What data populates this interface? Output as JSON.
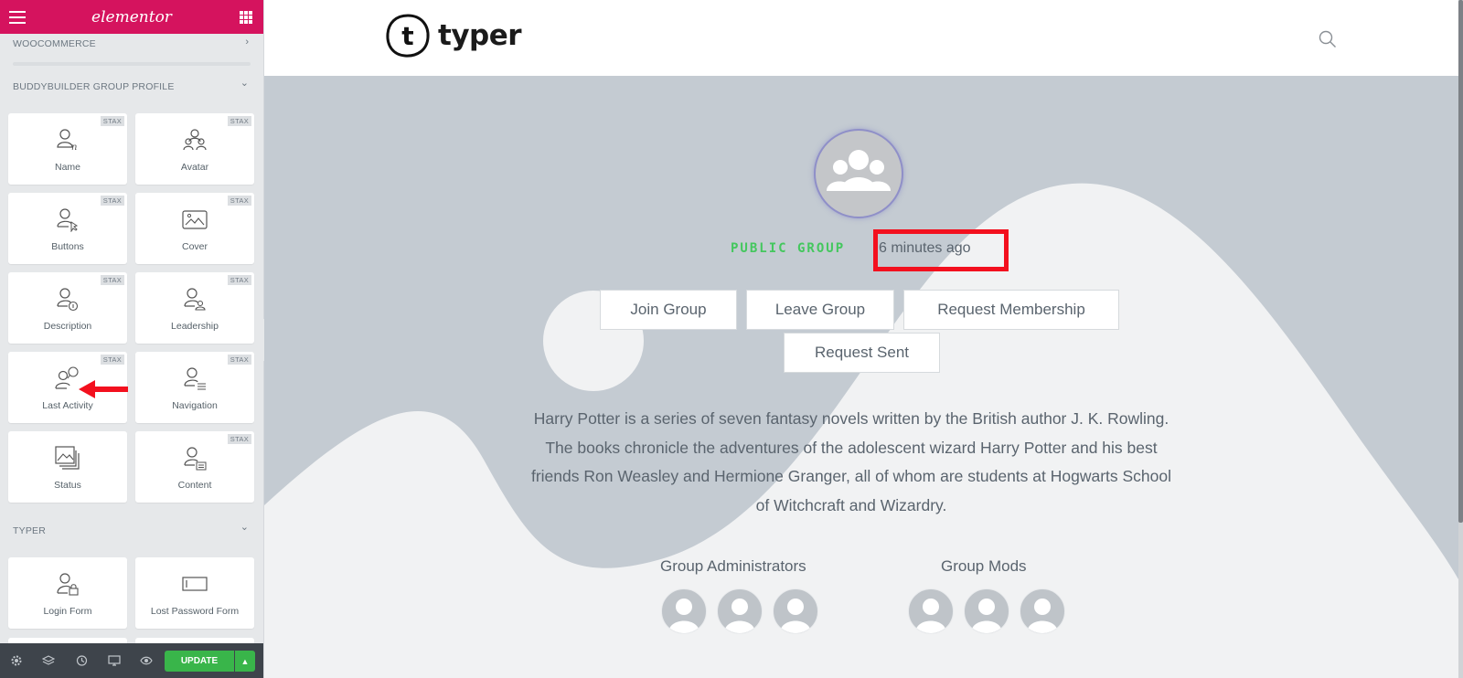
{
  "editor": {
    "logo": "elementor",
    "categories": [
      {
        "title": "WOOCOMMERCE",
        "chevron": "›"
      },
      {
        "title": "BUDDYBUILDER GROUP PROFILE",
        "chevron": "⌄"
      },
      {
        "title": "TYPER",
        "chevron": "⌄"
      }
    ],
    "badge": "STAX",
    "widgets_group_profile": [
      {
        "label": "Name",
        "icon": "user-name-icon"
      },
      {
        "label": "Avatar",
        "icon": "group-avatar-icon"
      },
      {
        "label": "Buttons",
        "icon": "user-cursor-icon"
      },
      {
        "label": "Cover",
        "icon": "cover-image-icon"
      },
      {
        "label": "Description",
        "icon": "user-info-icon"
      },
      {
        "label": "Leadership",
        "icon": "user-leader-icon"
      },
      {
        "label": "Last Activity",
        "icon": "user-activity-icon"
      },
      {
        "label": "Navigation",
        "icon": "user-navigation-icon"
      },
      {
        "label": "Status",
        "icon": "gallery-icon"
      },
      {
        "label": "Content",
        "icon": "user-content-icon"
      }
    ],
    "widgets_typer": [
      {
        "label": "Login Form",
        "icon": "user-lock-icon"
      },
      {
        "label": "Lost Password Form",
        "icon": "form-field-icon"
      }
    ],
    "footer": {
      "update_label": "UPDATE",
      "update_caret": "▲"
    }
  },
  "site": {
    "brand_name": "typer",
    "brand_letter": "t"
  },
  "group": {
    "type": "PUBLIC GROUP",
    "last_active": "6 minutes ago",
    "buttons": [
      "Join Group",
      "Leave Group",
      "Request Membership",
      "Request Sent"
    ],
    "description": "Harry Potter is a series of seven fantasy novels written by the British author J. K. Rowling. The books chronicle the adventures of the adolescent wizard Harry Potter and his best friends Ron Weasley and Hermione Granger, all of whom are students at Hogwarts School of Witchcraft and Wizardry.",
    "administrators_title": "Group Administrators",
    "mods_title": "Group Mods"
  },
  "colors": {
    "elementor_pink": "#d5135e",
    "update_green": "#39b54a",
    "group_type_green": "#44c75e",
    "highlight_red": "#f3101e"
  }
}
